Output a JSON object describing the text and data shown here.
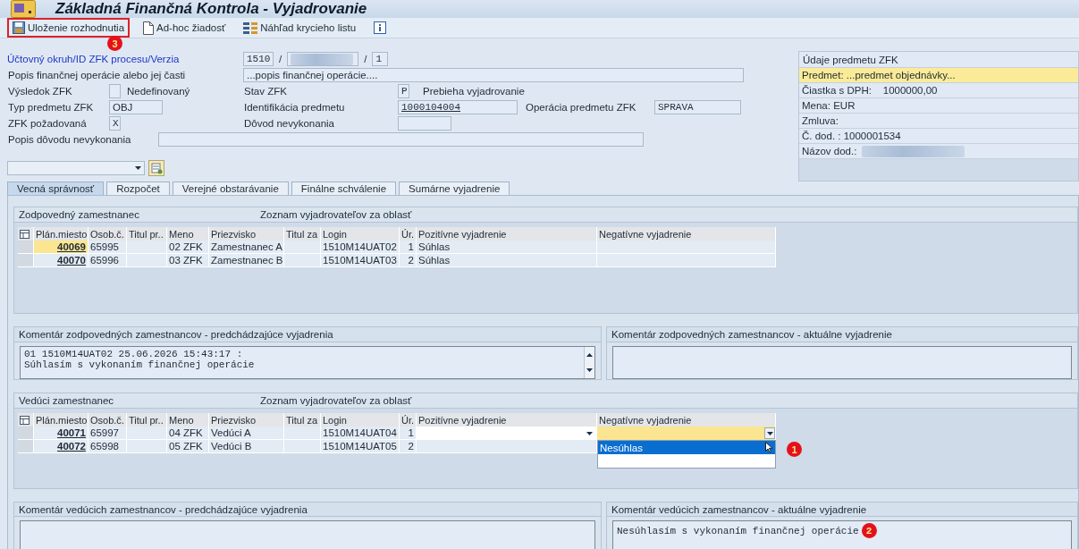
{
  "window": {
    "title": "Základná Finančná Kontrola - Vyjadrovanie"
  },
  "toolbar": [
    {
      "kind": "save",
      "label": "Uloženie rozhodnutia",
      "highlighted": true,
      "callout": "3"
    },
    {
      "kind": "document",
      "label": "Ad-hoc žiadosť",
      "highlighted": false
    },
    {
      "kind": "grid",
      "label": "Náhľad krycieho listu",
      "highlighted": false
    },
    {
      "kind": "info",
      "highlighted": false
    }
  ],
  "header": {
    "key_label": "Účtovný okruh/ID ZFK procesu/Verzia",
    "company_code": "1510",
    "separator_1": "/",
    "separator_2": "/",
    "version": "1",
    "description_label": "Popis finančnej operácie alebo jej časti",
    "description": "...popis finančnej operácie....",
    "result_label": "Výsledok ZFK",
    "result_text": "Nedefinovaný",
    "status_label": "Stav ZFK",
    "status_code": "P",
    "status_text": "Prebieha vyjadrovanie",
    "type_label": "Typ predmetu ZFK",
    "type_value": "OBJ",
    "ident_label": "Identifikácia predmetu",
    "ident_value": "1000104004",
    "operation_label": "Operácia predmetu ZFK",
    "operation_value": "SPRAVA",
    "required_label": "ZFK požadovaná",
    "required_value": "X",
    "reason_label": "Dôvod nevykonania",
    "reason_desc_label": "Popis dôvodu nevykonania"
  },
  "subject_panel": {
    "title": "Údaje predmetu ZFK",
    "lines": [
      {
        "text": "Predmet: ...predmet objednávky...",
        "selected": true,
        "redacted": false
      },
      {
        "text": "Čiastka s DPH:    1000000,00",
        "selected": false,
        "redacted": false
      },
      {
        "text": "Mena: EUR",
        "selected": false,
        "redacted": false
      },
      {
        "text": "Zmluva:",
        "selected": false,
        "redacted": false
      },
      {
        "text": "Č. dod. : 1000001534",
        "selected": false,
        "redacted": false
      },
      {
        "text": "Názov dod.:",
        "selected": false,
        "redacted": true
      }
    ]
  },
  "tabs": [
    {
      "label": "Vecná správnosť",
      "selected": true
    },
    {
      "label": "Rozpočet",
      "selected": false
    },
    {
      "label": "Verejné obstarávanie",
      "selected": false
    },
    {
      "label": "Finálne schválenie",
      "selected": false
    },
    {
      "label": "Sumárne vyjadrenie",
      "selected": false
    }
  ],
  "groups": [
    {
      "title": "Zodpovedný zamestnanec",
      "subtitle": "Zoznam vyjadrovateľov za oblasť",
      "columns": [
        "Plán.miesto",
        "Osob.č.",
        "Titul pr..",
        "Meno",
        "Priezvisko",
        "Titul za",
        "Login",
        "Úr.",
        "Pozitívne vyjadrenie",
        "Negatívne vyjadrenie"
      ],
      "rows": [
        {
          "kind": "display",
          "focused": true,
          "plan": "40069",
          "personal_no": "65995",
          "first_name": "02 ZFK",
          "last_name": "Zamestnanec A",
          "login": "1510M14UAT02",
          "order": "1",
          "positive": "Súhlas"
        },
        {
          "kind": "display",
          "focused": false,
          "plan": "40070",
          "personal_no": "65996",
          "first_name": "03 ZFK",
          "last_name": "Zamestnanec B",
          "login": "1510M14UAT03",
          "order": "2",
          "positive": "Súhlas"
        }
      ],
      "comments": [
        {
          "title": "Komentár zodpovedných zamestnancov - predchádzajúce vyjadrenia",
          "lines": [
            "01 1510M14UAT02 25.06.2026 15:43:17 :",
            "Súhlasím s vykonaním finančnej operácie"
          ],
          "scrollbar": true
        },
        {
          "title": "Komentár zodpovedných zamestnancov - aktuálne vyjadrenie",
          "scrollbar": false
        }
      ]
    },
    {
      "title": "Vedúci zamestnanec",
      "subtitle": "Zoznam vyjadrovateľov za oblasť",
      "columns": [
        "Plán.miesto",
        "Osob.č.",
        "Titul pr..",
        "Meno",
        "Priezvisko",
        "Titul za",
        "Login",
        "Úr.",
        "Pozitívne vyjadrenie",
        "Negatívne vyjadrenie"
      ],
      "rows": [
        {
          "kind": "edit",
          "focused": true,
          "plan": "40071",
          "personal_no": "65997",
          "first_name": "04 ZFK",
          "last_name": "Vedúci A",
          "login": "1510M14UAT04",
          "order": "1",
          "dropdown": {
            "callout": "1",
            "options": [
              {
                "label": "Nesúhlas",
                "selected": true
              }
            ]
          }
        },
        {
          "kind": "display",
          "focused": false,
          "plan": "40072",
          "personal_no": "65998",
          "first_name": "05 ZFK",
          "last_name": "Vedúci B",
          "login": "1510M14UAT05",
          "order": "2"
        }
      ],
      "comments": [
        {
          "title": "Komentár vedúcich zamestnancov - predchádzajúce vyjadrenia",
          "scrollbar": false
        },
        {
          "title": "Komentár vedúcich zamestnancov - aktuálne vyjadrenie",
          "lines": [
            "Nesúhlasím s vykonaním finančnej operácie"
          ],
          "callout": "2",
          "scrollbar": false
        }
      ]
    }
  ]
}
